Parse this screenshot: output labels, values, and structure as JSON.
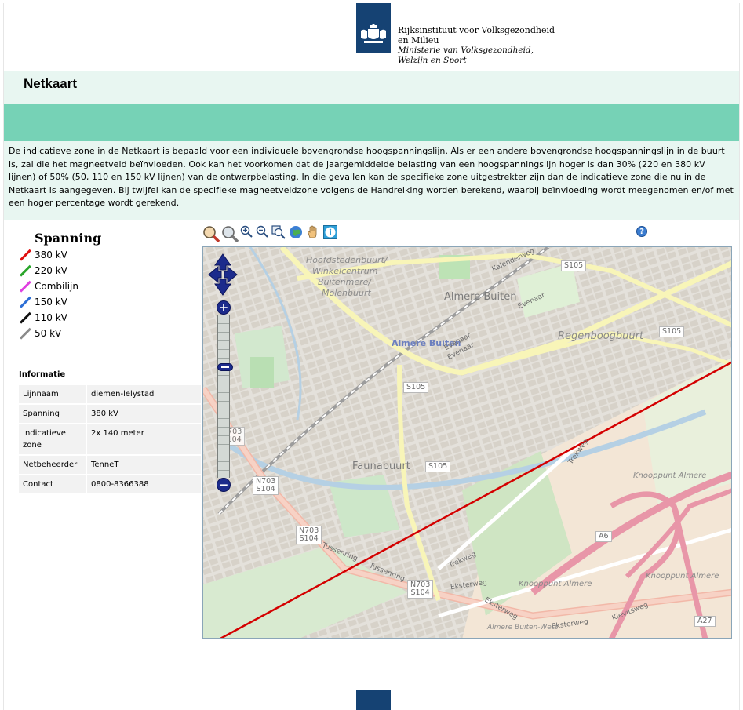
{
  "header": {
    "org_line1": "Rijksinstituut voor Volksgezondheid",
    "org_line2": "en Milieu",
    "org_line3": "Ministerie van Volksgezondheid,",
    "org_line4": "Welzijn en Sport"
  },
  "page": {
    "title": "Netkaart",
    "intro": "De indicatieve zone in de Netkaart is bepaald voor een individuele bovengrondse hoogspanningslijn. Als er een andere bovengrondse hoogspanningslijn in de buurt is, zal die het magneetveld beïnvloeden. Ook kan het voorkomen dat de jaargemiddelde belasting van een hoogspanningslijn hoger is dan 30% (220 en 380 kV lijnen) of 50% (50, 110 en 150 kV lijnen) van de ontwerpbelasting. In die gevallen kan de specifieke zone uitgestrekter zijn dan de indicatieve zone die nu in de Netkaart is aangegeven. Bij twijfel kan de specifieke magneetveldzone volgens de Handreiking worden berekend, waarbij beïnvloeding wordt meegenomen en/of met een hoger percentage wordt gerekend."
  },
  "legend": {
    "title": "Spanning",
    "items": [
      {
        "label": "380 kV",
        "color": "#e01010"
      },
      {
        "label": "220 kV",
        "color": "#2aa52a"
      },
      {
        "label": "Combilijn",
        "color": "#e040e0"
      },
      {
        "label": "150 kV",
        "color": "#2d6fd6"
      },
      {
        "label": "110 kV",
        "color": "#111111"
      },
      {
        "label": "50 kV",
        "color": "#8a8a8a"
      }
    ]
  },
  "info": {
    "title": "Informatie",
    "rows": [
      {
        "key": "Lijnnaam",
        "value": "diemen-lelystad"
      },
      {
        "key": "Spanning",
        "value": "380 kV"
      },
      {
        "key": "Indicatieve zone",
        "value": "2x 140 meter"
      },
      {
        "key": "Netbeheerder",
        "value": "TenneT"
      },
      {
        "key": "Contact",
        "value": "0800-8366388"
      }
    ]
  },
  "toolbar": {
    "icons": [
      "zoom-box-in-icon",
      "zoom-box-out-icon",
      "zoom-in-icon",
      "zoom-out-icon",
      "zoom-extent-icon",
      "globe-icon",
      "pan-hand-icon",
      "info-icon"
    ],
    "help_label": "?"
  },
  "map": {
    "labels": {
      "hoofdsteden1": "Hoofdstedenbuurt/",
      "hoofdsteden2": "Winkelcentrum",
      "hoofdsteden3": "Buitenmere/",
      "hoofdsteden4": "Molenbuurt",
      "almere_buiten": "Almere Buiten",
      "almere_buiten_station": "Almere Buiten",
      "regenboogbuurt": "Regenboogbuurt",
      "faunabuurt": "Faunabuurt",
      "kalenderweg": "Kalenderweg",
      "evenaar1": "Evenaar",
      "evenaar2": "Evenaar",
      "evenaar3": "Evenaar",
      "trekweg1": "Trekweg",
      "trekweg2": "Trekweg",
      "tussenring1": "Tussenring",
      "tussenring2": "Tussenring",
      "eksterweg1": "Eksterweg",
      "eksterweg2": "Eksterweg",
      "eksterweg3": "Eksterweg",
      "kievitsweg": "Kievitsweg",
      "knooppunt1": "Knooppunt Almere",
      "knooppunt2": "Knooppunt Almere",
      "knooppunt3": "Knooppunt Almere",
      "almere_buiten_west": "Almere Buiten-West"
    },
    "shields": {
      "s105a": "S105",
      "s105b": "S105",
      "s105c": "S105",
      "s105d": "S105",
      "n703a": "N703",
      "s104a": "S104",
      "n703b": "N703",
      "s104b": "S104",
      "n703c": "N703",
      "s104c": "S104",
      "n703d": "N703",
      "s104d": "S104",
      "a6": "A6",
      "a27": "A27"
    },
    "zoom_in": "+",
    "zoom_out": "−",
    "line_color": "#d40000"
  }
}
